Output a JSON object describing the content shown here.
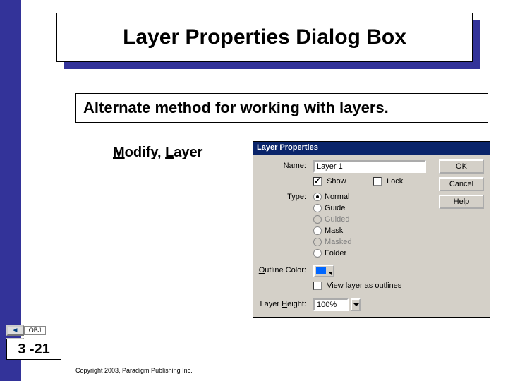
{
  "title": "Layer Properties Dialog Box",
  "subtitle": "Alternate method for working with layers.",
  "menu": {
    "m": "M",
    "odify": "odify, ",
    "l": "L",
    "ayer": "ayer"
  },
  "dialog": {
    "title": "Layer Properties",
    "name_label": "ame:",
    "name_u": "N",
    "name_value": "Layer 1",
    "show_u": "S",
    "show_label": "how",
    "lock_label": "Lock",
    "type_u": "T",
    "type_label": "ype:",
    "types": {
      "normal": "Normal",
      "guide": "Guide",
      "guided": "Guided",
      "mask": "Mask",
      "masked": "Masked",
      "folder": "Folder"
    },
    "outline_u": "O",
    "outline_label": "utline Color:",
    "view_label": "View layer as outlines",
    "height_label": "Layer ",
    "height_u": "H",
    "height_label2": "eight:",
    "height_value": "100%",
    "ok": "OK",
    "cancel": "Cancel",
    "help_u": "H",
    "help_label": "elp"
  },
  "nav": {
    "obj": "OBJ",
    "slide": "3 -21"
  },
  "copyright": "Copyright 2003, Paradigm Publishing Inc."
}
